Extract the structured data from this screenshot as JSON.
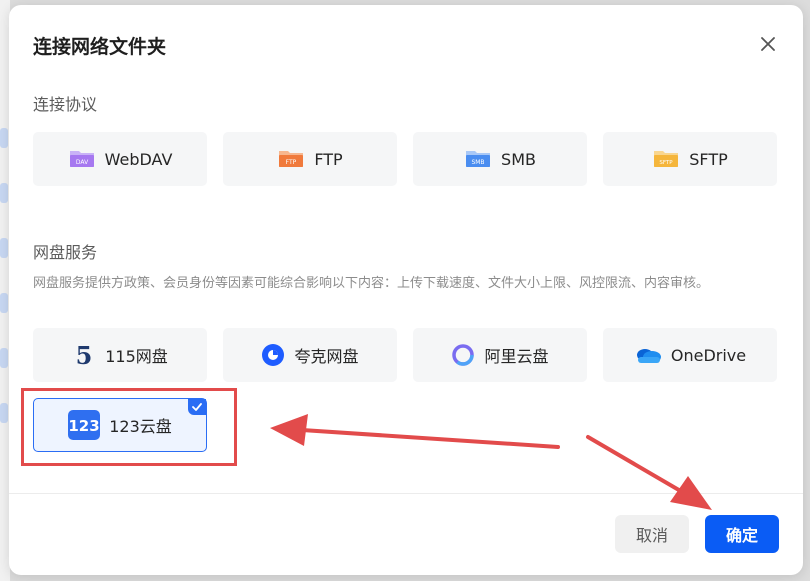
{
  "dialog": {
    "title": "连接网络文件夹",
    "protocol_section": "连接协议",
    "protocols": [
      {
        "label": "WebDAV",
        "icon": "webdav-icon",
        "badge": "DAV",
        "color": "#a678f0"
      },
      {
        "label": "FTP",
        "icon": "ftp-icon",
        "badge": "FTP",
        "color": "#f07a3c"
      },
      {
        "label": "SMB",
        "icon": "smb-icon",
        "badge": "SMB",
        "color": "#4a8df0"
      },
      {
        "label": "SFTP",
        "icon": "sftp-icon",
        "badge": "SFTP",
        "color": "#f5b63c"
      }
    ],
    "cloud_section": "网盘服务",
    "cloud_desc": "网盘服务提供方政策、会员身份等因素可能综合影响以下内容：上传下载速度、文件大小上限、风控限流、内容审核。",
    "clouds": [
      {
        "label": "115网盘",
        "icon": "115-logo-icon",
        "glyph": "5"
      },
      {
        "label": "夸克网盘",
        "icon": "quark-logo-icon"
      },
      {
        "label": "阿里云盘",
        "icon": "aliyun-logo-icon"
      },
      {
        "label": "OneDrive",
        "icon": "onedrive-logo-icon"
      },
      {
        "label": "123云盘",
        "icon": "123pan-logo-icon",
        "glyph": "123",
        "selected": true
      }
    ],
    "cancel_label": "取消",
    "confirm_label": "确定"
  },
  "colors": {
    "primary": "#0a5cf5",
    "selected_border": "#2a6df4",
    "annotation": "#e24b4b"
  }
}
